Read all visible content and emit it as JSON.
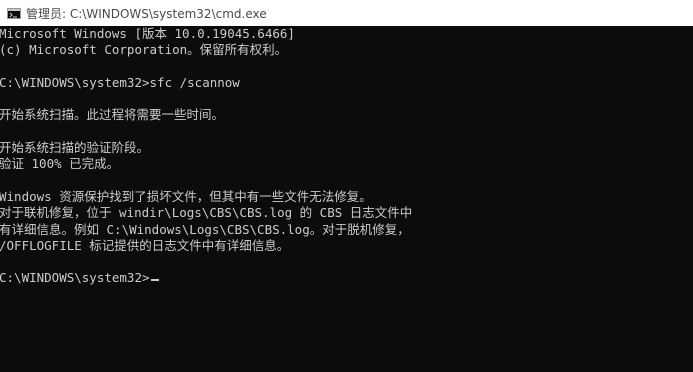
{
  "window": {
    "title": "管理员: C:\\WINDOWS\\system32\\cmd.exe",
    "icon": "cmd-icon"
  },
  "console": {
    "lines": [
      "Microsoft Windows [版本 10.0.19045.6466]",
      "(c) Microsoft Corporation。保留所有权利。",
      "",
      "C:\\WINDOWS\\system32>sfc /scannow",
      "",
      "开始系统扫描。此过程将需要一些时间。",
      "",
      "开始系统扫描的验证阶段。",
      "验证 100% 已完成。",
      "",
      "Windows 资源保护找到了损坏文件，但其中有一些文件无法修复。",
      "对于联机修复，位于 windir\\Logs\\CBS\\CBS.log 的 CBS 日志文件中",
      "有详细信息。例如 C:\\Windows\\Logs\\CBS\\CBS.log。对于脱机修复，",
      "/OFFLOGFILE 标记提供的日志文件中有详细信息。",
      "",
      "C:\\WINDOWS\\system32>"
    ],
    "colors": {
      "background": "#0c0c0c",
      "foreground": "#cccccc"
    }
  }
}
